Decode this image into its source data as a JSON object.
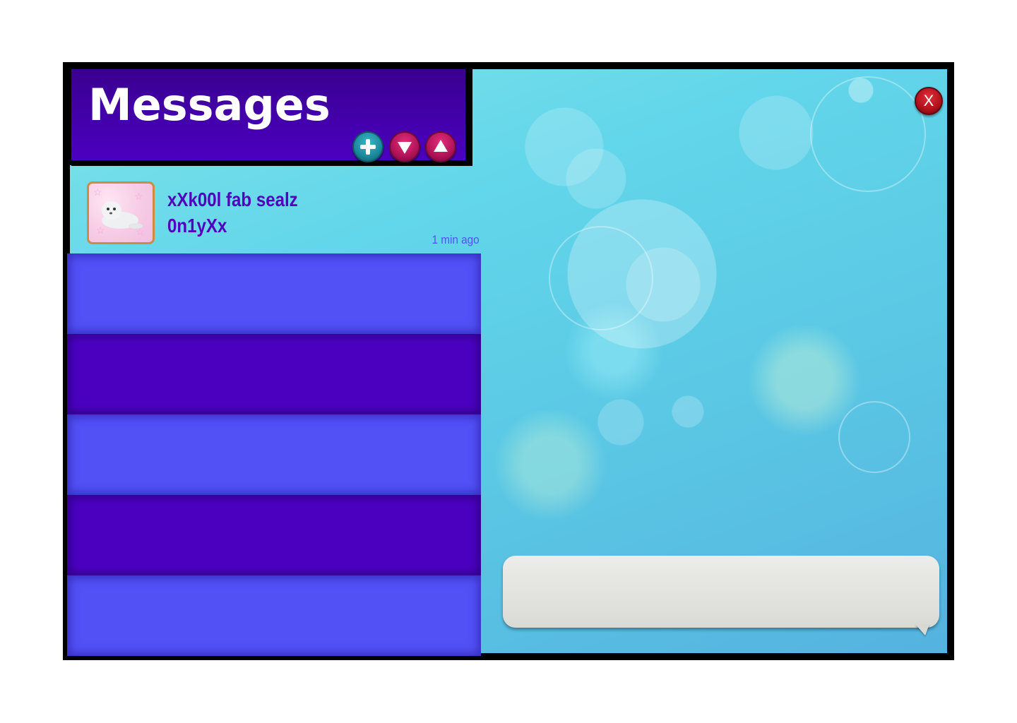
{
  "header": {
    "title": "Messages",
    "buttons": [
      {
        "icon": "plus-icon"
      },
      {
        "icon": "arrow-down-icon"
      },
      {
        "icon": "arrow-up-icon"
      }
    ]
  },
  "conversations": [
    {
      "name": "xXk00l fab sealz\n0n1yXx",
      "avatar_icon": "seal-avatar",
      "time": "1 min ago"
    }
  ],
  "empty_slots": 5,
  "close_label": "X",
  "composer": {
    "value": "",
    "placeholder": ""
  },
  "colors": {
    "header_bg": "#4b00c0",
    "slot_light": "#5151f6",
    "slot_dark": "#4b00c0",
    "name_text": "#5200bd",
    "timestamp_text": "#4d55f0",
    "add_button": "#1a8a9c",
    "arrow_buttons": "#b01258",
    "close_button": "#b1101b"
  }
}
